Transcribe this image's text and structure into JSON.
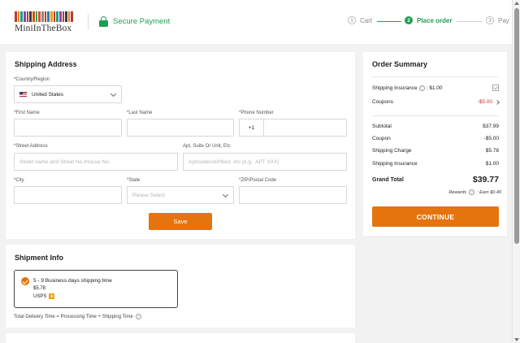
{
  "brand": {
    "name": "MiniInTheBox",
    "bar_colors": [
      "#c0392b",
      "#e67e22",
      "#16a085",
      "#8e44ad",
      "#c0392b",
      "#2c3e50",
      "#d35400",
      "#27ae60",
      "#e74c3c",
      "#7f8c8d",
      "#c0392b",
      "#2980b9",
      "#f39c12",
      "#c0392b",
      "#16a085",
      "#8e44ad",
      "#c0392b",
      "#2c3e50",
      "#e67e22",
      "#c0392b"
    ]
  },
  "header": {
    "secure_label": "Secure Payment",
    "steps": [
      {
        "num": "1",
        "label": "Cart"
      },
      {
        "num": "2",
        "label": "Place order"
      },
      {
        "num": "3",
        "label": "Pay"
      }
    ]
  },
  "shipping": {
    "title": "Shipping Address",
    "country_label": "*Country/Region",
    "country_value": "United States",
    "first_name_label": "*First Name",
    "last_name_label": "*Last Name",
    "phone_label": "*Phone Number",
    "phone_prefix": "+1",
    "street_label": "*Street Address",
    "street_placeholder": "Street name and Street No./House No.",
    "apt_label": "Apt, Suite Or Unit, Etc",
    "apt_placeholder": "Apt/suite/unit/floor, etc (e.g.: APT XXX)",
    "city_label": "*City",
    "state_label": "*State",
    "state_placeholder": "Please Select",
    "zip_label": "*ZIP/Postal Code",
    "save_label": "Save"
  },
  "shipment": {
    "title": "Shipment Info",
    "option_title": "5 - 9 Business days shipping time",
    "option_price": "$5.78",
    "option_carrier": "USPS",
    "total_time": "Total Delivery Time = Processing Time + Shipping Time"
  },
  "summary": {
    "title": "Order Summary",
    "insurance_label": "Shipping Insurance",
    "insurance_value": ": $1.00",
    "coupons_label": "Coupons",
    "coupons_value": "-$5.00",
    "subtotal_label": "Subtotal",
    "subtotal_value": "$37.99",
    "coupon_label": "Coupon",
    "coupon_value": "-$5.00",
    "shipping_charge_label": "Shipping Charge",
    "shipping_charge_value": "$5.78",
    "shipping_insurance_label": "Shipping Insurance",
    "shipping_insurance_value": "$1.00",
    "grand_total_label": "Grand Total",
    "grand_total_value": "$39.77",
    "rewards_label": "Rewards",
    "rewards_value": ": Earn $0.40",
    "continue_label": "CONTINUE"
  },
  "icons": {
    "help": "?",
    "star": "★"
  }
}
